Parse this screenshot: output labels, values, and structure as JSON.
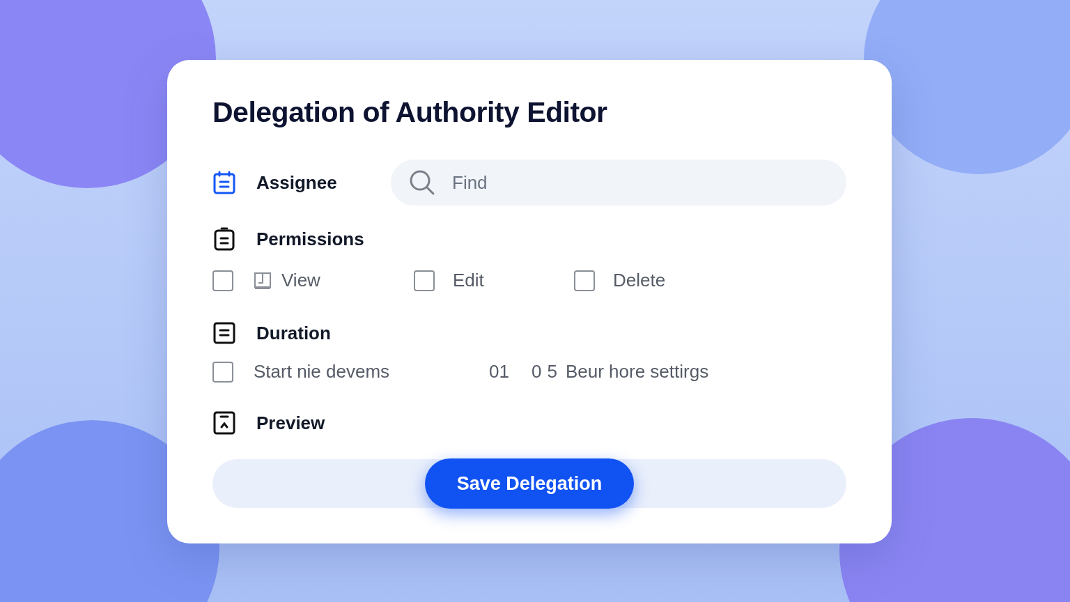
{
  "title": "Delegation of Authority Editor",
  "assignee": {
    "label": "Assignee",
    "search": {
      "placeholder": "Find"
    }
  },
  "permissions": {
    "label": "Permissions",
    "options": [
      {
        "label": "View",
        "checked": false,
        "has_icon": true
      },
      {
        "label": "Edit",
        "checked": false,
        "has_icon": false
      },
      {
        "label": "Delete",
        "checked": false,
        "has_icon": false
      }
    ]
  },
  "duration": {
    "label": "Duration",
    "start": {
      "label": "Start nie devems",
      "checked": false
    },
    "values": [
      "01",
      "0",
      "5"
    ],
    "settings": "Beur hore settirgs"
  },
  "preview": {
    "label": "Preview"
  },
  "save_button": "Save Delegation"
}
